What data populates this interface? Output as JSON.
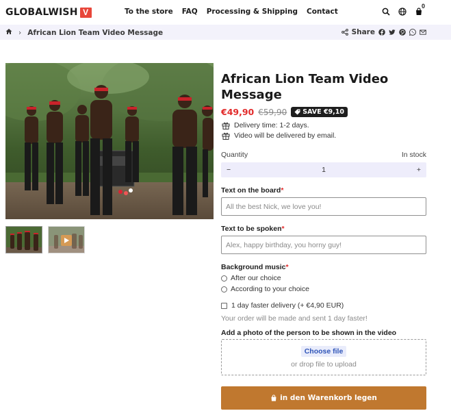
{
  "brand": {
    "name": "GLOBALWISH",
    "mark": "V"
  },
  "nav": [
    {
      "label": "To the store"
    },
    {
      "label": "FAQ"
    },
    {
      "label": "Processing & Shipping"
    },
    {
      "label": "Contact"
    }
  ],
  "header": {
    "cart_count": "0",
    "icons": [
      "search-icon",
      "globe-icon",
      "cart-icon"
    ]
  },
  "breadcrumb": {
    "current": "African Lion Team Video Message",
    "home_icon": "home-icon"
  },
  "share": {
    "label": "Share",
    "icons": [
      "facebook-icon",
      "twitter-icon",
      "pinterest-icon",
      "whatsapp-icon",
      "mail-icon"
    ]
  },
  "product": {
    "title": "African Lion Team Video Message",
    "price": "€49,90",
    "price_old": "€59,90",
    "save_badge": "SAVE €9,10",
    "info": [
      "Delivery time: 1-2 days.",
      "Video will be delivered by email."
    ],
    "quantity": {
      "label": "Quantity",
      "stock": "In stock",
      "minus": "−",
      "value": "1",
      "plus": "+"
    },
    "board": {
      "label": "Text on the board",
      "required": "*",
      "placeholder": "All the best Nick, we love you!"
    },
    "spoken": {
      "label": "Text to be spoken",
      "required": "*",
      "placeholder": "Alex, happy birthday, you horny guy!"
    },
    "music": {
      "label": "Background music",
      "required": "*",
      "options": [
        "After our choice",
        "According to your choice"
      ]
    },
    "faster": {
      "label": "1 day faster delivery (+ €4,90 EUR)",
      "note": "Your order will be made and sent 1 day faster!"
    },
    "upload": {
      "label": "Add a photo of the person to be shown in the video",
      "button": "Choose file",
      "drop": "or drop file to upload"
    },
    "cart_button": "in den Warenkorb legen"
  }
}
